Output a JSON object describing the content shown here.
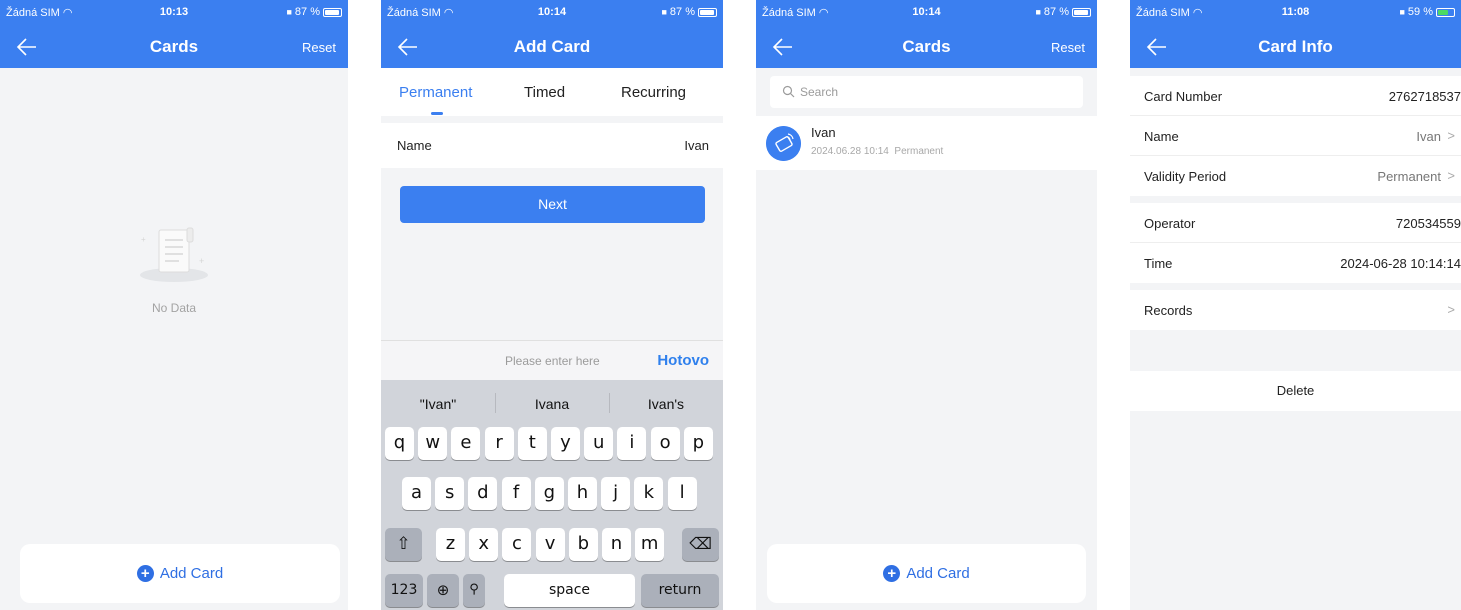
{
  "status": {
    "carrier": "Žádná SIM",
    "s1_time": "10:13",
    "s1_battery": "87 %",
    "s2_time": "10:14",
    "s2_battery": "87 %",
    "s3_time": "10:14",
    "s3_battery": "87 %",
    "s4_time": "11:08",
    "s4_battery": "59 %"
  },
  "colors": {
    "primary": "#3b7ff0",
    "background": "#f3f4f6",
    "keyboard": "#d1d4da"
  },
  "icons": [
    "back-arrow-icon",
    "wifi-icon",
    "battery-icon",
    "lock-icon",
    "empty-document-icon",
    "plus-circle-icon",
    "search-icon",
    "card-icon",
    "chevron-right-icon",
    "globe-icon",
    "microphone-icon",
    "shift-icon",
    "backspace-icon"
  ],
  "cards_empty": {
    "title": "Cards",
    "reset": "Reset",
    "empty_text": "No Data",
    "add_card": "Add Card"
  },
  "add_card": {
    "title": "Add Card",
    "tabs": [
      "Permanent",
      "Timed",
      "Recurring"
    ],
    "name_label": "Name",
    "name_value": "Ivan",
    "next": "Next",
    "input_placeholder": "Please enter here",
    "done": "Hotovo",
    "suggestions": [
      "\"Ivan\"",
      "Ivana",
      "Ivan's"
    ],
    "row1": [
      "q",
      "w",
      "e",
      "r",
      "t",
      "y",
      "u",
      "i",
      "o",
      "p"
    ],
    "row2": [
      "a",
      "s",
      "d",
      "f",
      "g",
      "h",
      "j",
      "k",
      "l"
    ],
    "row3": [
      "z",
      "x",
      "c",
      "v",
      "b",
      "n",
      "m"
    ],
    "key_123": "123",
    "key_space": "space",
    "key_return": "return"
  },
  "cards_list": {
    "title": "Cards",
    "reset": "Reset",
    "search_placeholder": "Search",
    "items": [
      {
        "name": "Ivan",
        "date": "2024.06.28 10:14",
        "type": "Permanent"
      }
    ],
    "add_card": "Add Card"
  },
  "card_info": {
    "title": "Card Info",
    "card_number_label": "Card Number",
    "card_number": "2762718537",
    "name_label": "Name",
    "name": "Ivan",
    "validity_label": "Validity Period",
    "validity": "Permanent",
    "operator_label": "Operator",
    "operator": "720534559",
    "time_label": "Time",
    "time": "2024-06-28 10:14:14",
    "records_label": "Records",
    "delete": "Delete"
  }
}
